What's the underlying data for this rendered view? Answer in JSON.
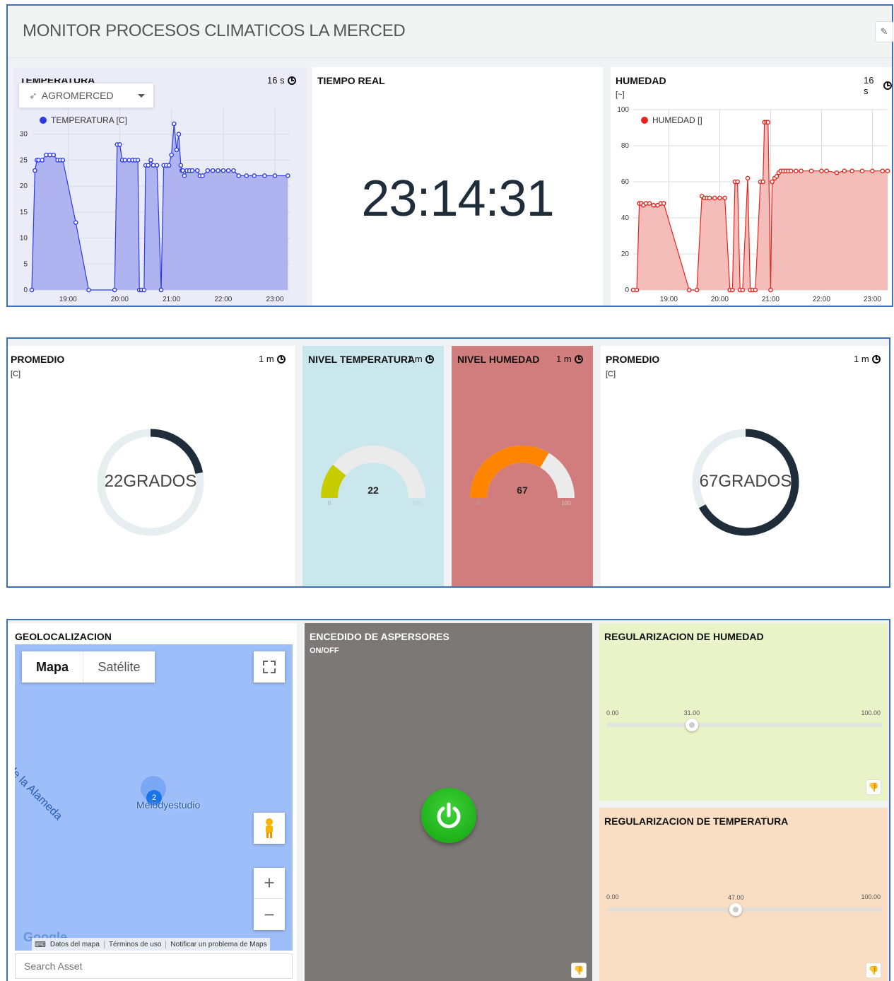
{
  "header": {
    "title": "MONITOR PROCESOS CLIMATICOS LA MERCED"
  },
  "temperature_widget": {
    "title": "TEMPERATURA",
    "ttl": "16 s",
    "asset_dropdown": "AGROMERCED",
    "legend": "TEMPERATURA [C]",
    "color": "#2d3be6",
    "fill": "#a9aef0",
    "chart_data": {
      "type": "area",
      "y_ticks": [
        "0",
        "5",
        "10",
        "15",
        "20",
        "25",
        "30"
      ],
      "x_ticks": [
        "19:00",
        "20:00",
        "21:00",
        "22:00",
        "23:00"
      ],
      "ylim": [
        0,
        35
      ],
      "series": [
        {
          "name": "TEMPERATURA [C]",
          "x": [
            18.3,
            18.36,
            18.4,
            18.43,
            18.5,
            18.58,
            18.65,
            18.72,
            18.8,
            18.85,
            18.9,
            19.15,
            19.4,
            19.9,
            19.95,
            20.0,
            20.05,
            20.1,
            20.18,
            20.25,
            20.3,
            20.35,
            20.38,
            20.42,
            20.47,
            20.5,
            20.55,
            20.6,
            20.65,
            20.72,
            20.8,
            20.85,
            20.9,
            20.95,
            21.0,
            21.05,
            21.1,
            21.14,
            21.18,
            21.2,
            21.22,
            21.25,
            21.3,
            21.35,
            21.4,
            21.5,
            21.55,
            21.6,
            21.7,
            21.8,
            21.9,
            22.0,
            22.1,
            22.2,
            22.3,
            22.45,
            22.6,
            22.8,
            23.0,
            23.25
          ],
          "y": [
            0,
            23,
            25,
            25,
            25,
            26,
            26,
            26,
            25,
            25,
            25,
            13,
            0,
            0,
            28,
            28,
            25,
            25,
            25,
            25,
            25,
            25,
            0,
            0,
            0,
            24,
            24,
            25,
            24,
            24,
            0,
            24,
            24,
            24,
            26,
            32,
            27,
            30,
            24,
            23,
            23,
            22,
            23,
            23,
            23,
            23,
            22,
            22,
            23,
            23,
            23,
            23,
            23,
            23,
            22,
            22,
            22,
            22,
            22,
            22
          ]
        }
      ]
    }
  },
  "clock_widget": {
    "title": "TIEMPO REAL",
    "time": "23:14:31"
  },
  "humidity_widget": {
    "title": "HUMEDAD",
    "unit": "[~]",
    "ttl": "16 s",
    "legend": "HUMEDAD []",
    "color": "#e8241d",
    "fill": "#f4b6b2",
    "chart_data": {
      "type": "area",
      "y_ticks": [
        "0",
        "20",
        "40",
        "60",
        "80",
        "100"
      ],
      "x_ticks": [
        "19:00",
        "20:00",
        "21:00",
        "22:00",
        "23:00"
      ],
      "ylim": [
        0,
        100
      ],
      "series": [
        {
          "name": "HUMEDAD []",
          "x": [
            18.3,
            18.37,
            18.42,
            18.46,
            18.5,
            18.55,
            18.62,
            18.7,
            18.78,
            18.84,
            18.9,
            19.4,
            19.55,
            19.65,
            19.7,
            19.75,
            19.8,
            19.9,
            20.0,
            20.1,
            20.2,
            20.25,
            20.3,
            20.35,
            20.4,
            20.45,
            20.55,
            20.6,
            20.65,
            20.7,
            20.8,
            20.85,
            20.88,
            20.92,
            20.95,
            21.0,
            21.03,
            21.08,
            21.12,
            21.16,
            21.2,
            21.25,
            21.3,
            21.35,
            21.4,
            21.5,
            21.6,
            21.8,
            22.0,
            22.1,
            22.3,
            22.45,
            22.6,
            22.8,
            23.0,
            23.2,
            23.3
          ],
          "y": [
            0,
            0,
            48,
            48,
            47,
            48,
            48,
            47,
            47,
            48,
            48,
            0,
            0,
            52,
            51,
            51,
            51,
            51,
            51,
            51,
            0,
            0,
            60,
            60,
            0,
            0,
            62,
            0,
            0,
            0,
            60,
            60,
            93,
            93,
            93,
            0,
            60,
            62,
            63,
            65,
            66,
            66,
            66,
            66,
            66,
            66,
            66,
            66,
            66,
            66,
            65,
            66,
            66,
            66,
            66,
            66,
            66
          ]
        }
      ]
    }
  },
  "avg_temp_widget": {
    "title": "PROMEDIO",
    "unit": "[C]",
    "ttl": "1 m",
    "value_text": "22GRADOS",
    "value": 22,
    "max": 100,
    "track_color": "#e6eeef",
    "arc_color": "#1f2d3a"
  },
  "temp_level_widget": {
    "title": "NIVEL TEMPERATURA",
    "ttl": "1 m",
    "value": "22",
    "min": "0",
    "max": "100",
    "level": 0.22,
    "bg": "#cbe7ee",
    "fill": "#c7cc00"
  },
  "hum_level_widget": {
    "title": "NIVEL HUMEDAD",
    "ttl": "1 m",
    "value": "67",
    "min": "0",
    "max": "100",
    "level": 0.67,
    "bg": "#d17d7d",
    "fill": "#ff8400"
  },
  "avg_hum_widget": {
    "title": "PROMEDIO",
    "unit": "[C]",
    "ttl": "1 m",
    "value_text": "67GRADOS",
    "value": 67,
    "max": 100,
    "track_color": "#e6eeef",
    "arc_color": "#1f2d3a"
  },
  "geo_widget": {
    "title": "GEOLOCALIZACION",
    "map_type_map": "Mapa",
    "map_type_satellite": "Satélite",
    "lake_label": "guna de la Alameda",
    "place_label": "Melodyestudio",
    "cluster_count": "2",
    "google_logo": "Google",
    "footer_data": "Datos del mapa",
    "footer_terms": "Términos de uso",
    "footer_report": "Notificar un problema de Maps",
    "search_placeholder": "Search Asset"
  },
  "sprinkler_widget": {
    "title": "ENCEDIDO DE ASPERSORES",
    "subtitle": "ON/OFF",
    "bg": "#7c7876",
    "button_color": "#1fb913"
  },
  "hum_reg_widget": {
    "title": "REGULARIZACION DE HUMEDAD",
    "min": "0.00",
    "value": "31.00",
    "max": "100.00",
    "level": 0.31,
    "bg": "#eaf3c8"
  },
  "temp_reg_widget": {
    "title": "REGULARIZACION DE TEMPERATURA",
    "min": "0.00",
    "value": "47.00",
    "max": "100.00",
    "level": 0.47,
    "bg": "#f9dec4"
  }
}
